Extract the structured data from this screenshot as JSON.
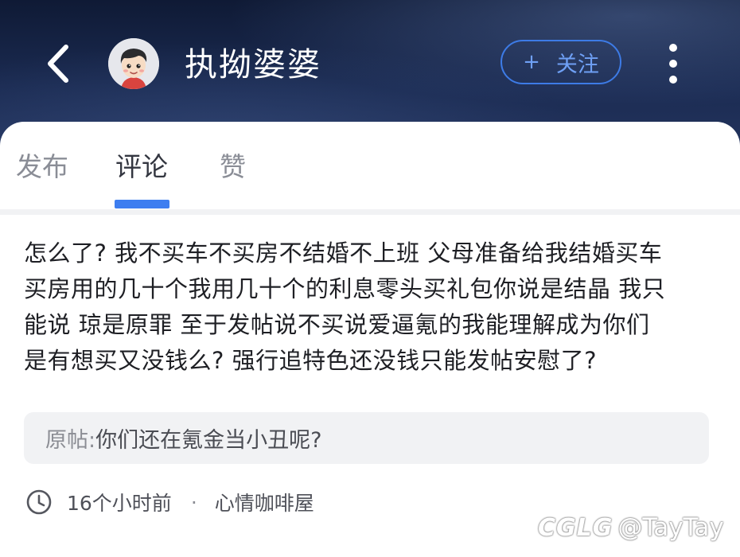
{
  "header": {
    "user_name": "执拗婆婆",
    "follow_icon": "+",
    "follow_label": "关注",
    "back_icon": "chevron-left-icon",
    "more_icon": "more-vertical-icon",
    "avatar": "cartoon-boy-avatar"
  },
  "tabs": [
    {
      "label": "发布",
      "active": false
    },
    {
      "label": "评论",
      "active": true
    },
    {
      "label": "赞",
      "active": false
    }
  ],
  "comment": {
    "lines": [
      "怎么了? 我不买车不买房不结婚不上班 父母准备给我结婚买车",
      "买房用的几十个我用几十个的利息零头买礼包你说是结晶 我只",
      "能说 琼是原罪 至于发帖说不买说爱逼氪的我能理解成为你们",
      "是有想买又没钱么? 强行追特色还没钱只能发帖安慰了?"
    ],
    "original_post": {
      "label": "原帖: ",
      "text": "你们还在氪金当小丑呢?"
    },
    "meta": {
      "time": "16个小时前",
      "separator": "·",
      "category": "心情咖啡屋"
    }
  },
  "watermark": {
    "logo": "CGLG",
    "handle": "@TayTay"
  },
  "colors": {
    "accent": "#3e7ef0",
    "header_bg": "#1b2b52",
    "follow_border": "#3d7be6"
  }
}
